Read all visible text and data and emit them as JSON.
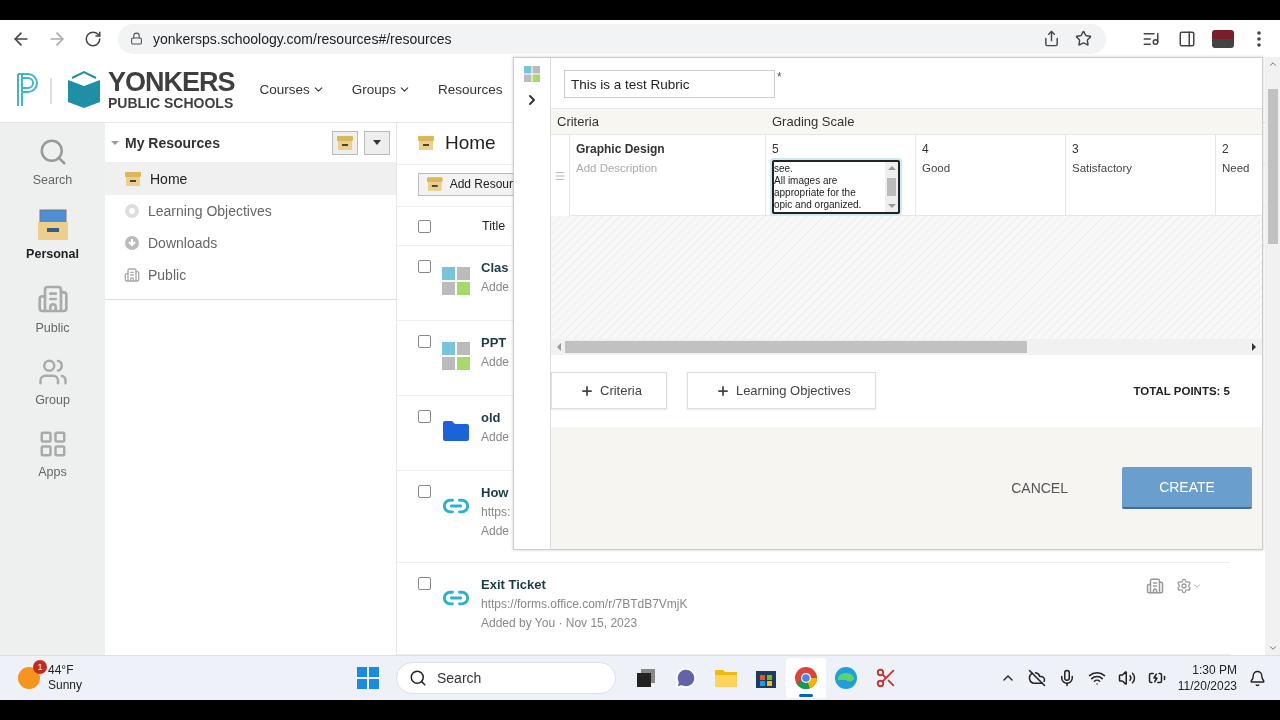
{
  "browser": {
    "url": "yonkersps.schoology.com/resources#/resources"
  },
  "header": {
    "logo_top": "YONKERS",
    "logo_bottom": "PUBLIC SCHOOLS",
    "nav": [
      {
        "label": "Courses",
        "dropdown": true
      },
      {
        "label": "Groups",
        "dropdown": true
      },
      {
        "label": "Resources",
        "dropdown": false
      }
    ]
  },
  "rail": [
    {
      "label": "Search",
      "kind": "search",
      "selected": false
    },
    {
      "label": "Personal",
      "kind": "personal",
      "selected": true
    },
    {
      "label": "Public",
      "kind": "public",
      "selected": false
    },
    {
      "label": "Group",
      "kind": "group",
      "selected": false
    },
    {
      "label": "Apps",
      "kind": "apps",
      "selected": false
    }
  ],
  "tree": {
    "title": "My Resources",
    "expanded": true,
    "items": [
      {
        "label": "Home",
        "kind": "home",
        "selected": true
      },
      {
        "label": "Learning Objectives",
        "kind": "objectives",
        "selected": false
      },
      {
        "label": "Downloads",
        "kind": "downloads",
        "selected": false
      },
      {
        "label": "Public",
        "kind": "public",
        "selected": false
      }
    ]
  },
  "content": {
    "title": "Home",
    "add_button": "Add Resour",
    "column": "Title",
    "all_checked": false,
    "rows": [
      {
        "kind": "grid",
        "title": "Clas",
        "lines": [
          "Adde"
        ],
        "checked": false
      },
      {
        "kind": "grid",
        "title": "PPT",
        "lines": [
          "Adde"
        ],
        "checked": false
      },
      {
        "kind": "folder",
        "title": "old",
        "lines": [
          "Adde"
        ],
        "checked": false
      },
      {
        "kind": "link",
        "title": "How",
        "lines": [
          "https:",
          "Adde"
        ],
        "checked": false
      },
      {
        "kind": "link",
        "title": "Exit Ticket",
        "lines": [
          "https://forms.office.com/r/7BTdB7VmjK",
          "Added by You · Nov 15, 2023"
        ],
        "tools": true,
        "checked": false
      }
    ]
  },
  "rubric": {
    "title_value": "This is a test Rubric",
    "required": "*",
    "headers": [
      "Criteria",
      "Grading Scale"
    ],
    "criteria": [
      {
        "name": "Graphic Design",
        "description_placeholder": "Add Description",
        "levels": [
          {
            "points": "5",
            "kind": "editing",
            "lines": [
              "see.",
              "All images are",
              "appropriate for the",
              "opic and organized."
            ]
          },
          {
            "points": "4",
            "kind": "text",
            "label": "Good"
          },
          {
            "points": "3",
            "kind": "text",
            "label": "Satisfactory"
          },
          {
            "points": "2",
            "kind": "text",
            "label": "Need"
          }
        ]
      }
    ],
    "add_buttons": [
      "Criteria",
      "Learning Objectives"
    ],
    "total": "TOTAL POINTS: 5",
    "cancel": "CANCEL",
    "create": "CREATE"
  },
  "taskbar": {
    "weather": {
      "badge": "1",
      "temp": "44°F",
      "condition": "Sunny"
    },
    "search_label": "Search",
    "apps": [
      {
        "kind": "taskview",
        "selected": false
      },
      {
        "kind": "chat",
        "selected": false
      },
      {
        "kind": "files",
        "selected": false
      },
      {
        "kind": "store",
        "selected": false
      },
      {
        "kind": "chrome",
        "selected": true
      },
      {
        "kind": "edge",
        "selected": false
      },
      {
        "kind": "snip",
        "selected": false
      }
    ],
    "time": "1:30 PM",
    "date": "11/20/2023"
  }
}
